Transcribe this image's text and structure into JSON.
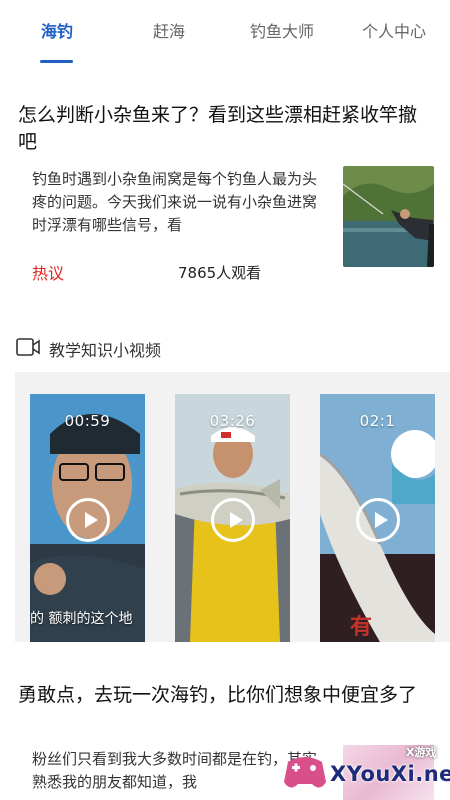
{
  "tabs": [
    {
      "label": "海钓",
      "active": true
    },
    {
      "label": "赶海",
      "active": false
    },
    {
      "label": "钓鱼大师",
      "active": false
    },
    {
      "label": "个人中心",
      "active": false
    }
  ],
  "article1": {
    "title": "怎么判断小杂鱼来了？看到这些漂相赶紧收竿撤吧",
    "summary": "钓鱼时遇到小杂鱼闹窝是每个钓鱼人最为头疼的问题。今天我们来说一说有小杂鱼进窝时浮漂有哪些信号，看",
    "badge": "热议",
    "views": "7865人观看"
  },
  "video_section": {
    "icon": "camera-icon",
    "title": "教学知识小视频",
    "videos": [
      {
        "duration": "00:59",
        "caption": "的 额刺的这个地"
      },
      {
        "duration": "03:26",
        "caption": ""
      },
      {
        "duration": "02:1",
        "caption": ""
      }
    ]
  },
  "article2": {
    "title": "勇敢点，去玩一次海钓，比你们想象中便宜多了",
    "summary": "粉丝们只看到我大多数时间都是在钓，其实熟悉我的朋友都知道，我"
  },
  "watermark": {
    "small": "X游戏",
    "text": "XYouXi.net"
  },
  "colors": {
    "accent": "#1f5fc5",
    "badge": "#e2231a"
  }
}
